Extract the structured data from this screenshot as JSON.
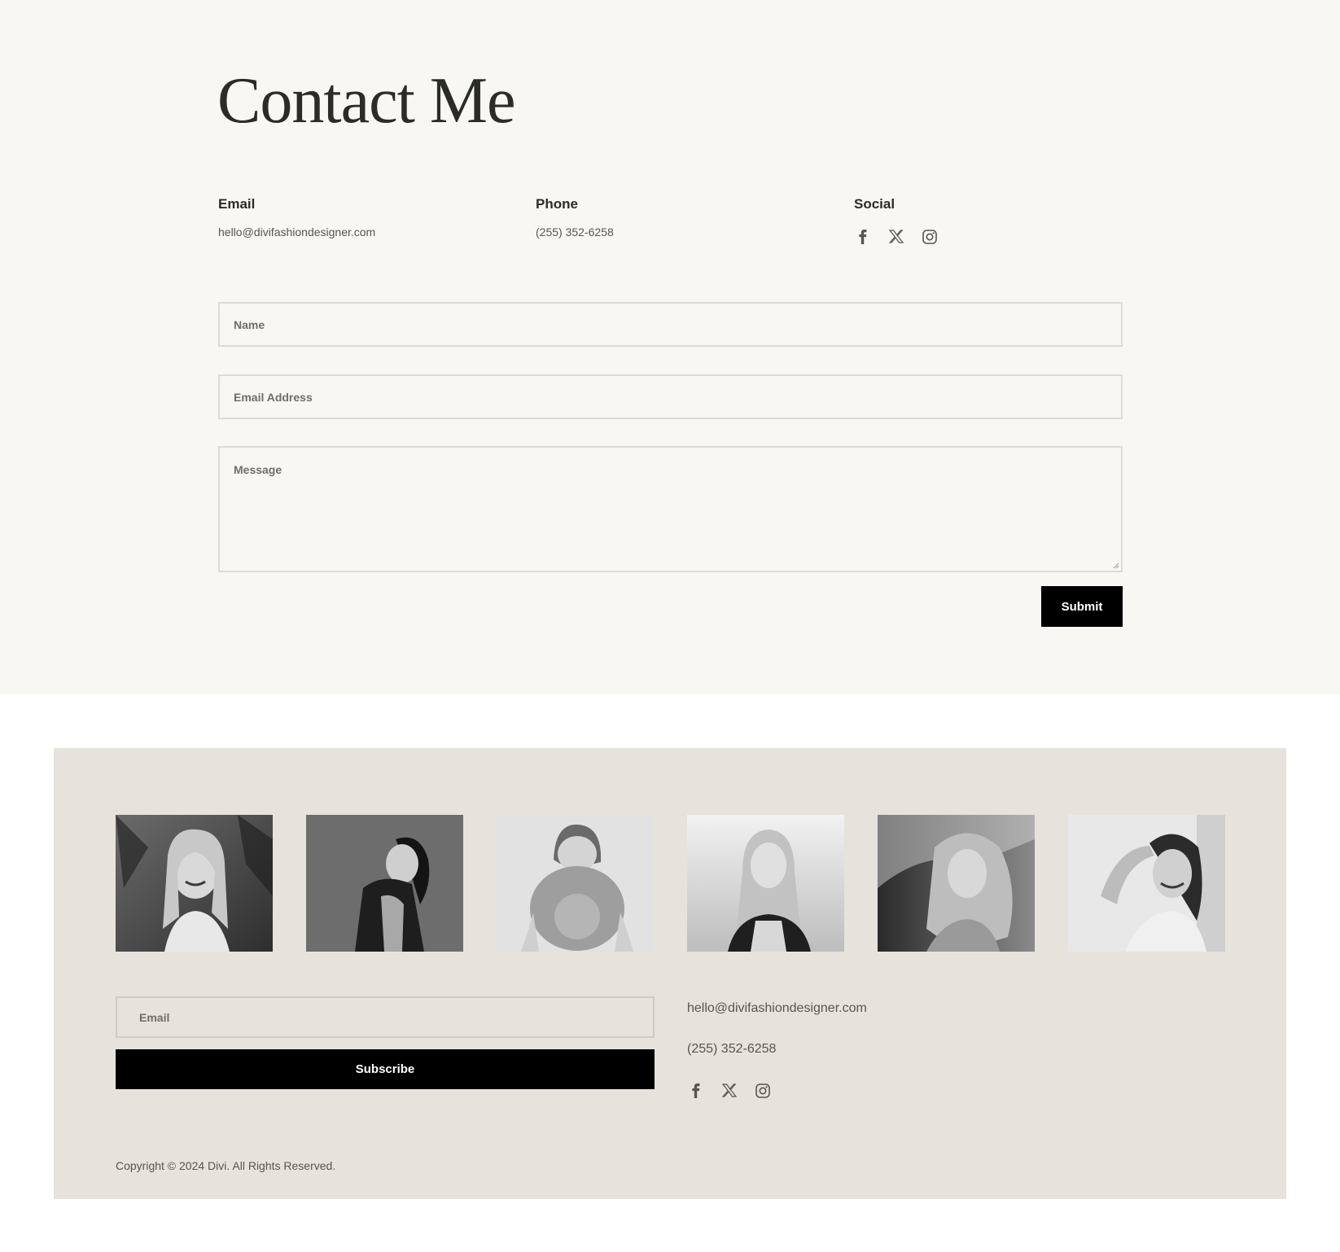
{
  "contact": {
    "title": "Contact Me",
    "email_heading": "Email",
    "email_value": "hello@divifashiondesigner.com",
    "phone_heading": "Phone",
    "phone_value": "(255) 352-6258",
    "social_heading": "Social",
    "social_icons": [
      "facebook-icon",
      "x-icon",
      "instagram-icon"
    ]
  },
  "form": {
    "name_placeholder": "Name",
    "email_placeholder": "Email Address",
    "message_placeholder": "Message",
    "submit_label": "Submit"
  },
  "footer": {
    "photos": [
      "woman with long hair among palm leaves",
      "woman in leather jacket looking down",
      "woman holding hat over face",
      "woman with blonde hair outdoors",
      "woman with windblown hair",
      "smiling woman leaning against wall"
    ],
    "newsletter_placeholder": "Email",
    "subscribe_label": "Subscribe",
    "email": "hello@divifashiondesigner.com",
    "phone": "(255) 352-6258",
    "social_icons": [
      "facebook-icon",
      "x-icon",
      "instagram-icon"
    ],
    "copyright": "Copyright © 2024 Divi. All Rights Reserved."
  },
  "colors": {
    "contact_bg": "#f9f7f4",
    "footer_bg": "#e6e3dd",
    "button_bg": "#000000",
    "text_dark": "#2b2b28",
    "text_muted": "#55564f"
  }
}
